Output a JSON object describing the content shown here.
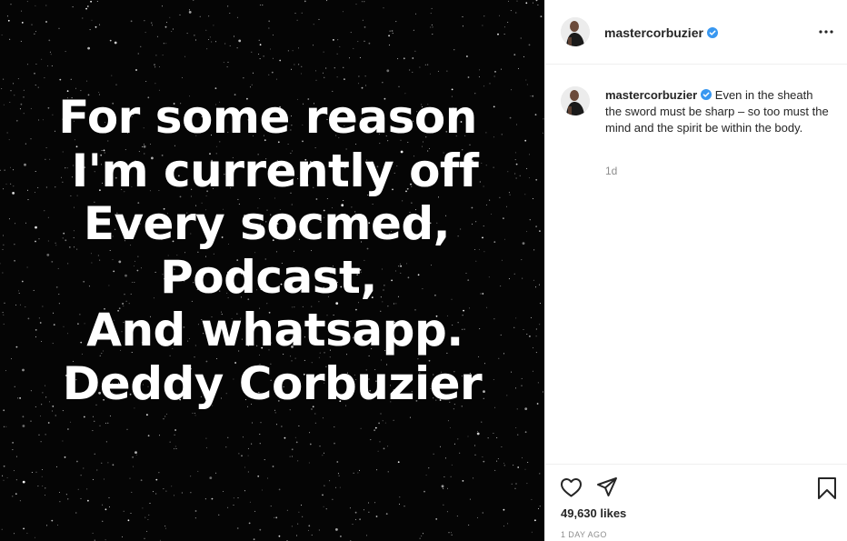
{
  "post": {
    "image_text": {
      "lines": [
        "For some reason",
        "I'm currently off",
        "Every socmed,",
        "Podcast,",
        "And whatsapp.",
        "Deddy Corbuzier"
      ]
    },
    "author": {
      "username": "mastercorbuzier",
      "verified": true,
      "verified_icon": "verified-badge-icon"
    },
    "caption": {
      "username": "mastercorbuzier",
      "text": "Even in the sheath the sword must be sharp – so too must the mind and the spirit be within the body.",
      "time_ago": "1d"
    },
    "actions": {
      "icons": [
        "heart-icon",
        "share-icon",
        "bookmark-icon"
      ],
      "likes": "49,630 likes",
      "date": "1 DAY AGO"
    },
    "menu_icon": "more-options-icon"
  },
  "colors": {
    "verified_blue": "#3897f0",
    "text": "#262626",
    "muted": "#8e8e8e",
    "border": "#efefef",
    "media_bg": "#050505"
  }
}
